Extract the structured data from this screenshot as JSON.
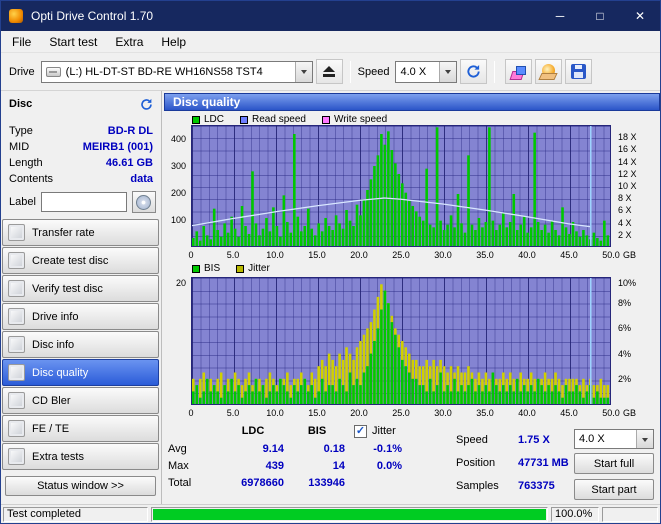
{
  "window": {
    "title": "Opti Drive Control 1.70",
    "controls": {
      "minimize": "─",
      "maximize": "□",
      "close": "✕"
    }
  },
  "menu": {
    "items": [
      "File",
      "Start test",
      "Extra",
      "Help"
    ]
  },
  "toolbar": {
    "drive_label": "Drive",
    "drive_value": "(L:)  HL-DT-ST BD-RE  WH16NS58 TST4",
    "speed_label": "Speed",
    "speed_value": "4.0 X"
  },
  "sidebar": {
    "disc_header": "Disc",
    "info": [
      {
        "label": "Type",
        "value": "BD-R DL"
      },
      {
        "label": "MID",
        "value": "MEIRB1 (001)"
      },
      {
        "label": "Length",
        "value": "46.61 GB"
      },
      {
        "label": "Contents",
        "value": "data"
      }
    ],
    "label_field": {
      "label": "Label",
      "value": ""
    },
    "buttons": [
      {
        "label": "Transfer rate",
        "selected": false
      },
      {
        "label": "Create test disc",
        "selected": false
      },
      {
        "label": "Verify test disc",
        "selected": false
      },
      {
        "label": "Drive info",
        "selected": false
      },
      {
        "label": "Disc info",
        "selected": false
      },
      {
        "label": "Disc quality",
        "selected": true
      },
      {
        "label": "CD Bler",
        "selected": false
      },
      {
        "label": "FE / TE",
        "selected": false
      },
      {
        "label": "Extra tests",
        "selected": false
      }
    ],
    "status_window": "Status window >>"
  },
  "main": {
    "panel_title": "Disc quality",
    "legend1": [
      {
        "label": "LDC",
        "color": "#00c800"
      },
      {
        "label": "Read speed",
        "color": "#6e7eff"
      },
      {
        "label": "Write speed",
        "color": "#ff78ff"
      }
    ],
    "legend2": [
      {
        "label": "BIS",
        "color": "#00c800"
      },
      {
        "label": "Jitter",
        "color": "#b8b800"
      }
    ]
  },
  "stats": {
    "col1": "LDC",
    "col2": "BIS",
    "rows": [
      {
        "label": "Avg",
        "ldc": "9.14",
        "bis": "0.18",
        "jitter": "-0.1%"
      },
      {
        "label": "Max",
        "ldc": "439",
        "bis": "14",
        "jitter": "0.0%"
      },
      {
        "label": "Total",
        "ldc": "6978660",
        "bis": "133946",
        "jitter": ""
      }
    ],
    "jitter_checkbox": "Jitter",
    "speed_label": "Speed",
    "speed_value": "1.75 X",
    "speed_select": "4.0 X",
    "position_label": "Position",
    "position_value": "47731 MB",
    "samples_label": "Samples",
    "samples_value": "763375",
    "start_full": "Start full",
    "start_part": "Start part"
  },
  "statusbar": {
    "text": "Test completed",
    "percent": "100.0%"
  },
  "colors": {
    "titlebar": "#16285f",
    "accent": "#2b5cd8",
    "chart_bg": "#8484d2",
    "bar_green": "#00c800",
    "jitter_yellow": "#d0d000",
    "read_line": "#d8e6ff",
    "cursor": "#9fd4ff",
    "value_navy": "#0000bf",
    "progress_green": "#00cc22"
  },
  "chart_data": [
    {
      "type": "bar",
      "title": "LDC errors with read speed overlay",
      "x_unit": "GB",
      "x_range": [
        0,
        50
      ],
      "x_ticks": [
        "0",
        "5.0",
        "10.0",
        "15.0",
        "20.0",
        "25.0",
        "30.0",
        "35.0",
        "40.0",
        "45.0",
        "50.0"
      ],
      "y_left_ticks": [
        "400",
        "300",
        "200",
        "100"
      ],
      "y_left_max": 450,
      "y_right_ticks": [
        "18 X",
        "16 X",
        "14 X",
        "12 X",
        "10 X",
        "8 X",
        "6 X",
        "4 X",
        "2 X"
      ],
      "y_right_max": 20,
      "bar_color": "#00c800",
      "cursor_color": "#9fd4ff",
      "cursor_x_gb": 47.7,
      "bars": [
        30,
        55,
        20,
        75,
        40,
        25,
        140,
        60,
        35,
        85,
        50,
        110,
        65,
        35,
        150,
        75,
        45,
        280,
        85,
        40,
        65,
        105,
        55,
        145,
        75,
        35,
        190,
        90,
        50,
        420,
        110,
        55,
        75,
        140,
        65,
        40,
        85,
        55,
        105,
        75,
        60,
        115,
        85,
        65,
        135,
        95,
        75,
        155,
        115,
        175,
        210,
        250,
        300,
        340,
        420,
        380,
        430,
        360,
        310,
        270,
        235,
        200,
        170,
        150,
        130,
        110,
        95,
        290,
        80,
        70,
        445,
        95,
        60,
        80,
        115,
        70,
        195,
        85,
        50,
        340,
        80,
        60,
        105,
        70,
        90,
        445,
        95,
        60,
        80,
        125,
        70,
        90,
        195,
        60,
        80,
        110,
        50,
        70,
        425,
        90,
        60,
        80,
        50,
        95,
        60,
        40,
        145,
        70,
        45,
        90,
        55,
        35,
        60,
        40,
        25,
        50,
        30,
        20,
        95,
        40
      ],
      "read_speed_line": {
        "color": "#d8e6ff",
        "x": [
          0,
          5,
          10,
          15,
          20,
          23,
          25,
          30,
          35,
          40,
          45,
          47.7
        ],
        "speed": [
          3.4,
          4.6,
          5.7,
          6.7,
          7.6,
          8.0,
          7.8,
          7.0,
          6.0,
          4.9,
          3.7,
          3.2
        ]
      }
    },
    {
      "type": "bar",
      "title": "BIS errors and jitter",
      "x_unit": "GB",
      "x_range": [
        0,
        50
      ],
      "x_ticks": [
        "0",
        "5.0",
        "10.0",
        "15.0",
        "20.0",
        "25.0",
        "30.0",
        "35.0",
        "40.0",
        "45.0",
        "50.0"
      ],
      "y_left_ticks": [
        "20"
      ],
      "y_left_max": 20,
      "y_right_ticks": [
        "10%",
        "8%",
        "6%",
        "4%",
        "2%"
      ],
      "y_right_max": 10,
      "bis_color": "#00c800",
      "jitter_color": "#d0d000",
      "cursor_color": "#9fd4ff",
      "cursor_x_gb": 47.7,
      "bis_bars": [
        2,
        3,
        1,
        2,
        4,
        2,
        3,
        2,
        1,
        3,
        2,
        4,
        2,
        3,
        1,
        2,
        3,
        2,
        4,
        2,
        3,
        1,
        2,
        3,
        2,
        4,
        3,
        2,
        1,
        3,
        2,
        3,
        4,
        2,
        3,
        1,
        2,
        4,
        2,
        3,
        3,
        2,
        4,
        3,
        2,
        5,
        3,
        4,
        3,
        5,
        6,
        8,
        10,
        12,
        15,
        18,
        16,
        13,
        11,
        9,
        7,
        6,
        5,
        4,
        4,
        3,
        3,
        2,
        4,
        2,
        3,
        5,
        2,
        3,
        2,
        4,
        2,
        3,
        2,
        3,
        4,
        2,
        3,
        2,
        3,
        2,
        5,
        3,
        2,
        3,
        2,
        3,
        2,
        4,
        2,
        3,
        2,
        3,
        2,
        4,
        3,
        2,
        3,
        2,
        3,
        2,
        1,
        3,
        2,
        2,
        3,
        2,
        1,
        2,
        3,
        1,
        2,
        1,
        1,
        1
      ],
      "jitter_bars": [
        4,
        3,
        4,
        5,
        3,
        4,
        3,
        4,
        5,
        3,
        4,
        3,
        5,
        4,
        3,
        4,
        5,
        3,
        4,
        4,
        3,
        4,
        5,
        4,
        3,
        4,
        4,
        5,
        3,
        4,
        4,
        5,
        4,
        3,
        5,
        4,
        6,
        7,
        6,
        8,
        7,
        6,
        8,
        7,
        9,
        8,
        7,
        9,
        10,
        11,
        12,
        13,
        15,
        17,
        19,
        18,
        16,
        14,
        12,
        11,
        10,
        9,
        8,
        7,
        7,
        6,
        6,
        7,
        6,
        7,
        6,
        7,
        6,
        5,
        6,
        5,
        6,
        5,
        5,
        6,
        5,
        4,
        5,
        4,
        5,
        4,
        5,
        4,
        4,
        5,
        4,
        5,
        4,
        4,
        5,
        4,
        4,
        5,
        4,
        4,
        4,
        5,
        4,
        4,
        5,
        4,
        3,
        4,
        4,
        4,
        4,
        3,
        4,
        3,
        4,
        3,
        3,
        4,
        3,
        3
      ]
    }
  ]
}
